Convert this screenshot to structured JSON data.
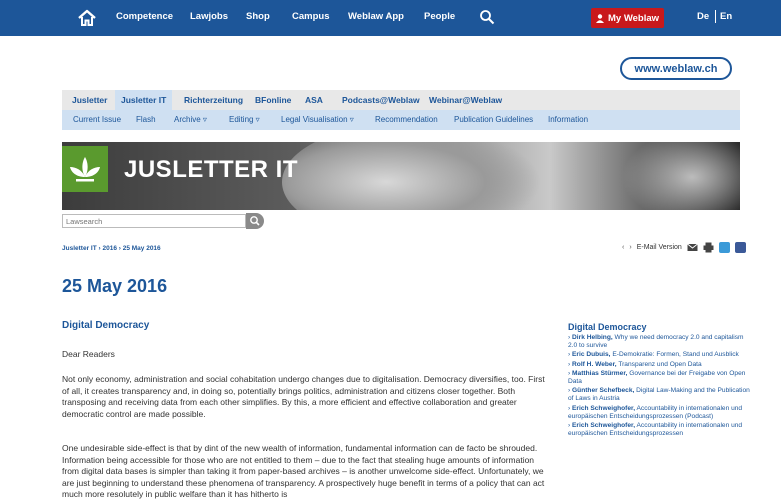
{
  "nav": {
    "items": [
      "Competence",
      "Lawjobs",
      "Shop",
      "Campus",
      "Weblaw App",
      "People"
    ],
    "my_weblaw": "My Weblaw",
    "lang_de": "De",
    "lang_en": "En"
  },
  "url_pill": "www.weblaw.ch",
  "tabs": [
    "Jusletter",
    "Jusletter IT",
    "Richterzeitung",
    "BFonline",
    "ASA",
    "Podcasts@Weblaw",
    "Webinar@Weblaw"
  ],
  "subtabs": [
    "Current Issue",
    "Flash",
    "Archive ▿",
    "Editing ▿",
    "Legal Visualisation ▿",
    "Recommendation",
    "Publication Guidelines",
    "Information"
  ],
  "banner_title": "JUSLETTER IT",
  "search_placeholder": "Lawsearch",
  "breadcrumb": [
    "Jusletter IT",
    "2016",
    "25 May 2016"
  ],
  "email_version": "E-Mail Version",
  "page_title": "25 May 2016",
  "section_title": "Digital Democracy",
  "paragraphs": [
    "Dear Readers",
    "Not only economy, administration and social cohabitation undergo changes due to digitalisation. Democracy diversifies, too. First of all, it creates transparency and, in doing so, potentially brings politics, administration and citizens closer together. Both transposing and receiving data from each other simplifies. By this, a more efficient and effective collaboration and greater democratic control are made possible.",
    "One undesirable side-effect is that by dint of the new wealth of information, fundamental information can de facto be shrouded. Information being accessible for those who are not entitled to them – due to the fact that stealing huge amounts of information from digital data bases is simpler than taking it from paper-based archives – is another unwelcome side-effect. Unfortunately, we are just beginning to understand these phenomena of transparency. A prospectively huge benefit in terms of a policy that can act much more resolutely in public welfare than it has hitherto is"
  ],
  "sidebar": {
    "title": "Digital Democracy",
    "items": [
      {
        "author": "Dirk Helbing,",
        "text": "Why we need democracy 2.0 and capitalism 2.0 to survive"
      },
      {
        "author": "Eric Dubuis,",
        "text": "E-Demokratie: Formen, Stand und Ausblick"
      },
      {
        "author": "Rolf H. Weber,",
        "text": "Transparenz und Open Data"
      },
      {
        "author": "Matthias Stürmer,",
        "text": "Governance bei der Freigabe von Open Data"
      },
      {
        "author": "Günther Schefbeck,",
        "text": "Digital Law-Making and the Publication of Laws in Austria"
      },
      {
        "author": "Erich Schweighofer,",
        "text": "Accountability in internationalen und europäischen Entscheidungsprozessen (Podcast)"
      },
      {
        "author": "Erich Schweighofer,",
        "text": "Accountability in internationalen und europäischen Entscheidungsprozessen"
      }
    ]
  },
  "colors": {
    "brand_blue": "#1d5699",
    "accent_red": "#c8191b",
    "logo_green": "#5a9a2e"
  }
}
